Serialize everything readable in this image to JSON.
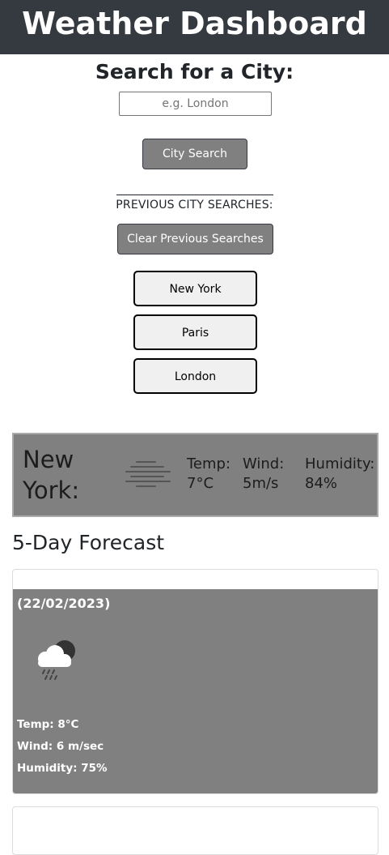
{
  "header": {
    "title": "Weather Dashboard"
  },
  "search": {
    "title": "Search for a City:",
    "placeholder": "e.g. London",
    "value": "",
    "button_label": "City Search"
  },
  "previous": {
    "label": "PREVIOUS CITY SEARCHES:",
    "clear_label": "Clear Previous Searches",
    "cities": [
      "New York",
      "Paris",
      "London"
    ]
  },
  "current": {
    "city": "New York:",
    "icon": "fog-icon",
    "temp_label": "Temp:",
    "temp_value": "7°C",
    "wind_label": "Wind:",
    "wind_value": "5m/s",
    "humidity_label": "Humidity:",
    "humidity_value": "84%"
  },
  "forecast": {
    "title": "5-Day Forecast",
    "days": [
      {
        "date": "(22/02/2023)",
        "icon": "night-rain-cloud-icon",
        "temp": "Temp: 8°C",
        "wind": "Wind: 6 m/sec",
        "humidity": "Humidity: 75%"
      }
    ]
  },
  "colors": {
    "header_bg": "#343a40",
    "button_bg": "#808080",
    "card_bg": "#808080"
  }
}
